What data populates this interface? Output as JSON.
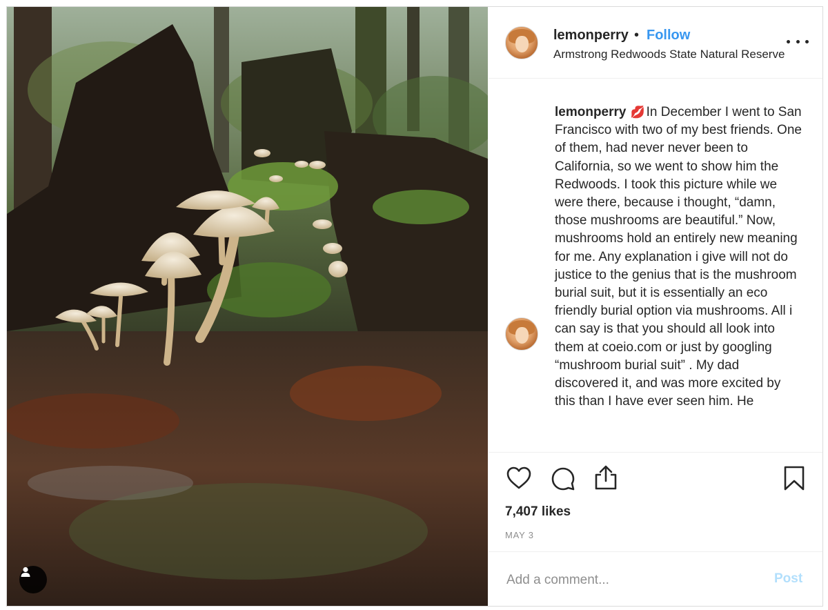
{
  "post": {
    "username": "lemonperry",
    "separator": "•",
    "follow_label": "Follow",
    "location": "Armstrong Redwoods State Natural Reserve",
    "more_icon": "more-options-icon"
  },
  "caption": {
    "username": "lemonperry",
    "emoji": "💋",
    "text": "In December I went to San Francisco with two of my best friends. One of them, had never never been to California, so we went to show him the Redwoods. I took this picture while we were there, because i thought, “damn, those mushrooms are beautiful.” Now, mushrooms hold an entirely new meaning for me. Any explanation i give will not do justice to the genius that is the mushroom burial suit, but it is essentially an eco friendly burial option via mushrooms. All i can say is that you should all look into them at coeio.com or just by googling “mushroom burial suit” . My dad discovered it, and was more excited by this than I have ever seen him. He"
  },
  "actions": {
    "like_icon": "heart-icon",
    "comment_icon": "comment-icon",
    "share_icon": "share-icon",
    "save_icon": "bookmark-icon"
  },
  "likes": "7,407 likes",
  "date": "MAY 3",
  "comment_box": {
    "placeholder": "Add a comment...",
    "post_label": "Post"
  },
  "photo": {
    "tag_icon": "user-tag-icon"
  },
  "colors": {
    "follow": "#3897f0",
    "post_disabled": "#b2dffc",
    "text": "#262626",
    "muted": "#8e8e8e",
    "kiss": "#d9263a"
  }
}
